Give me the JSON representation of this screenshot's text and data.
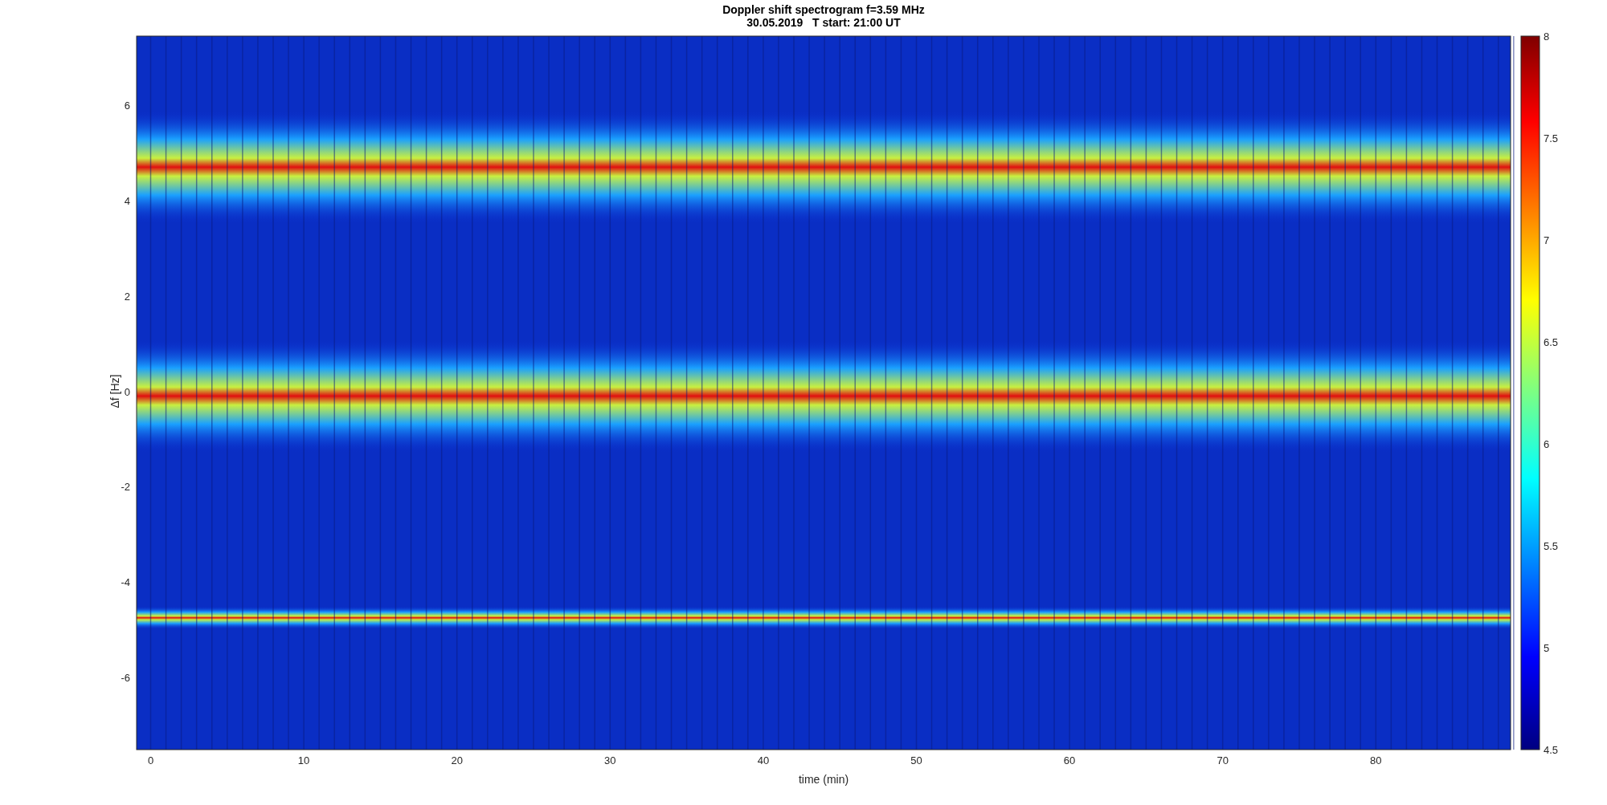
{
  "title": [
    "Doppler shift spectrogram f=3.59 MHz",
    "30.05.2019   T start: 21:00 UT"
  ],
  "axes": {
    "ylabel": "Δf [Hz]",
    "xlabel": "time (min)",
    "yticks": [
      "6",
      "4",
      "2",
      "0",
      "-2",
      "-4",
      "-6"
    ],
    "xticks": [
      "0",
      "10",
      "20",
      "30",
      "40",
      "50",
      "60",
      "70",
      "80"
    ]
  },
  "colorbar": {
    "ticks": [
      "8",
      "7.5",
      "7",
      "6.5",
      "6",
      "5.5",
      "5",
      "4.5"
    ]
  }
}
